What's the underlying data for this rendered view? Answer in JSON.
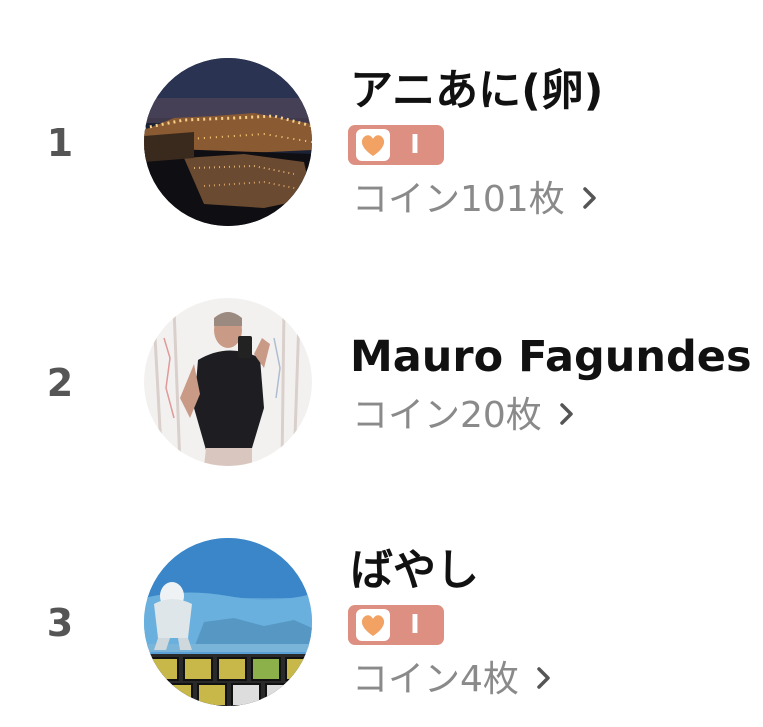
{
  "ranking": [
    {
      "rank": "1",
      "name": "アニあに(卵)",
      "badge_level": "I",
      "coins": "コイン101枚",
      "has_badge": true
    },
    {
      "rank": "2",
      "name": "Mauro Fagundes",
      "coins": "コイン20枚",
      "has_badge": false
    },
    {
      "rank": "3",
      "name": "ばやし",
      "badge_level": "I",
      "coins": "コイン4枚",
      "has_badge": true
    }
  ],
  "colors": {
    "badge": "#dd8f82",
    "heart": "#f2a262",
    "rank_text": "#555555",
    "coin_text": "#8a8a8a"
  }
}
